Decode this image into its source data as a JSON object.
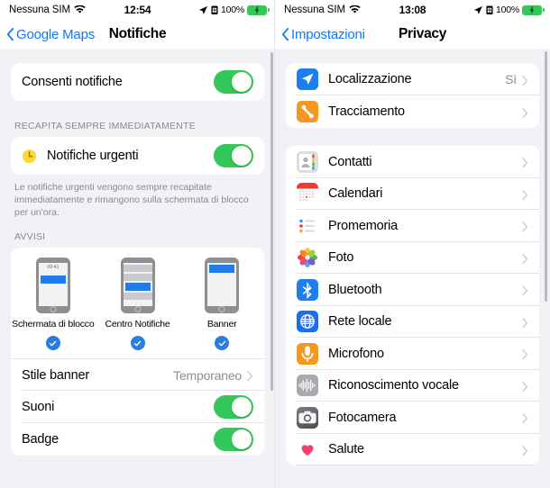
{
  "left": {
    "statusbar": {
      "carrier": "Nessuna SIM",
      "wifi_icon": "wifi-icon",
      "time": "12:54",
      "location_icon": "location-arrow-icon",
      "sim_icon": "sim-card-icon",
      "battery_percent": "100%",
      "battery_icon": "battery-charging-icon"
    },
    "nav": {
      "back_label": "Google Maps",
      "back_icon": "chevron-left-icon",
      "title": "Notifiche"
    },
    "allow_group": {
      "rows": [
        {
          "label": "Consenti notifiche",
          "control": "toggle",
          "on": true
        }
      ]
    },
    "urgent_group": {
      "header": "RECAPITA SEMPRE IMMEDIATAMENTE",
      "rows": [
        {
          "label": "Notifiche urgenti",
          "icon": "clock-icon",
          "control": "toggle",
          "on": true
        }
      ],
      "footer": "Le notifiche urgenti vengono sempre recapitate immediatamente e rimangono sulla schermata di blocco per un'ora."
    },
    "alerts_group": {
      "header": "AVVISI",
      "options": [
        {
          "label": "Schermata di blocco",
          "style": "lock-screen",
          "time": "09:41",
          "selected": true
        },
        {
          "label": "Centro Notifiche",
          "style": "notification-center",
          "selected": true
        },
        {
          "label": "Banner",
          "style": "banner",
          "selected": true
        }
      ],
      "rows": [
        {
          "label": "Stile banner",
          "value": "Temporaneo",
          "control": "chevron"
        },
        {
          "label": "Suoni",
          "control": "toggle",
          "on": true
        },
        {
          "label": "Badge",
          "control": "toggle",
          "on": true
        }
      ]
    }
  },
  "right": {
    "statusbar": {
      "carrier": "Nessuna SIM",
      "wifi_icon": "wifi-icon",
      "time": "13:08",
      "location_icon": "location-arrow-icon",
      "sim_icon": "sim-card-icon",
      "battery_percent": "100%",
      "battery_icon": "battery-charging-icon"
    },
    "nav": {
      "back_label": "Impostazioni",
      "back_icon": "chevron-left-icon",
      "title": "Privacy"
    },
    "group_one": [
      {
        "label": "Localizzazione",
        "value": "Sì",
        "icon": "location-services-icon"
      },
      {
        "label": "Tracciamento",
        "value": "",
        "icon": "tracking-icon"
      }
    ],
    "group_two": [
      {
        "label": "Contatti",
        "value": "",
        "icon": "contacts-icon"
      },
      {
        "label": "Calendari",
        "value": "",
        "icon": "calendar-icon"
      },
      {
        "label": "Promemoria",
        "value": "",
        "icon": "reminders-icon"
      },
      {
        "label": "Foto",
        "value": "",
        "icon": "photos-icon"
      },
      {
        "label": "Bluetooth",
        "value": "",
        "icon": "bluetooth-icon"
      },
      {
        "label": "Rete locale",
        "value": "",
        "icon": "local-network-icon"
      },
      {
        "label": "Microfono",
        "value": "",
        "icon": "microphone-icon"
      },
      {
        "label": "Riconoscimento vocale",
        "value": "",
        "icon": "speech-recognition-icon"
      },
      {
        "label": "Fotocamera",
        "value": "",
        "icon": "camera-icon"
      },
      {
        "label": "Salute",
        "value": "",
        "icon": "health-icon"
      }
    ]
  },
  "colors": {
    "toggle_on": "#34c759",
    "accent_blue": "#0a7aff",
    "check_blue": "#2a7cdd",
    "group_bg": "#ffffff",
    "page_bg": "#f1f1f6"
  }
}
